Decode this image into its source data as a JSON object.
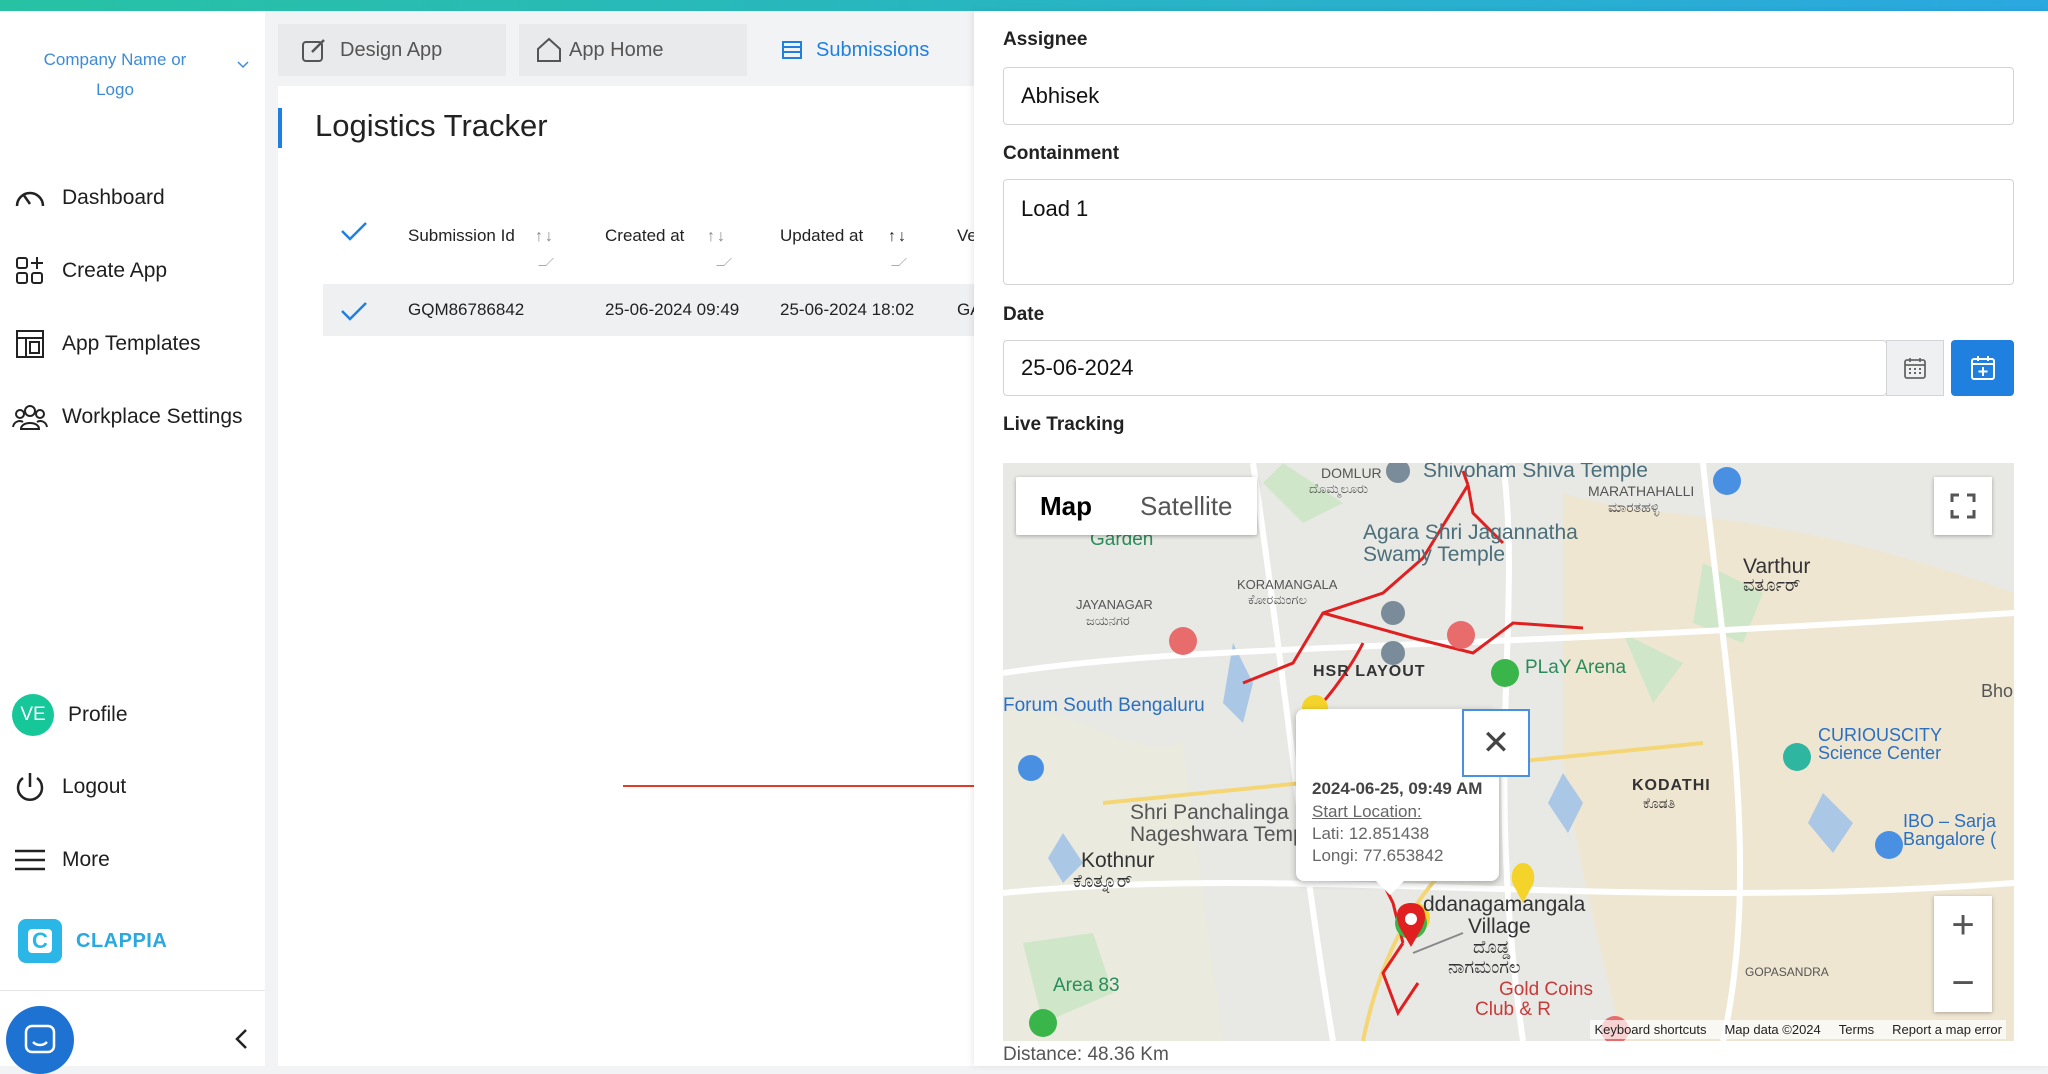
{
  "sidebar": {
    "company": "Company Name or Logo",
    "nav": [
      {
        "label": "Dashboard",
        "icon": "gauge-icon"
      },
      {
        "label": "Create App",
        "icon": "grid-plus-icon"
      },
      {
        "label": "App Templates",
        "icon": "template-icon"
      },
      {
        "label": "Workplace Settings",
        "icon": "people-icon"
      }
    ],
    "profile": {
      "initials": "VE",
      "label": "Profile"
    },
    "logout": "Logout",
    "more": "More",
    "brand": "CLAPPIA"
  },
  "tabs": [
    {
      "label": "Design App",
      "icon": "edit-icon"
    },
    {
      "label": "App Home",
      "icon": "home-icon"
    },
    {
      "label": "Submissions",
      "icon": "table-icon"
    }
  ],
  "page": {
    "title": "Logistics Tracker"
  },
  "table": {
    "columns": [
      "Submission Id",
      "Created at",
      "Updated at",
      "Ve"
    ],
    "rows": [
      {
        "id": "GQM86786842",
        "created": "25-06-2024 09:49",
        "updated": "25-06-2024 18:02",
        "extra": "GA"
      }
    ]
  },
  "form": {
    "assignee_label": "Assignee",
    "assignee_value": "Abhisek",
    "containment_label": "Containment",
    "containment_value": "Load 1",
    "date_label": "Date",
    "date_value": "25-06-2024",
    "tracking_label": "Live Tracking",
    "distance": "Distance: 48.36 Km"
  },
  "map": {
    "toggle": [
      "Map",
      "Satellite"
    ],
    "info": {
      "time": "2024-06-25, 09:49 AM",
      "start": "Start Location:",
      "lat": "Lati: 12.851438",
      "lng": "Longi: 77.653842"
    },
    "places": {
      "domlur": "DOMLUR",
      "domlur_kn": "ದೊಮ್ಮಲೂರು",
      "shivoham": "Shivoham Shiva Temple",
      "marathahalli": "MARATHAHALLI",
      "marathahalli_kn": "ಮಾರತಹಳ್ಳಿ",
      "garden": "Garden",
      "agara1": "Agara Shri Jagannatha",
      "agara2": "Swamy Temple",
      "koramangala": "KORAMANGALA",
      "koramangala_kn": "ಕೋರಮಂಗಲ",
      "jayanagar": "JAYANAGAR",
      "jayanagar_kn": "ಜಯನಗರ",
      "varthur": "Varthur",
      "varthur_kn": "ವರ್ತೂರ್",
      "hsr": "HSR LAYOUT",
      "play": "PLaY Arena",
      "forum": "Forum South Bengaluru",
      "curio1": "CURIOUSCITY",
      "curio2": "Science Center",
      "kodathi": "KODATHI",
      "kodathi_kn": "ಕೊಡತಿ",
      "shri1": "Shri Panchalinga",
      "shri2": "Nageshwara Temple",
      "ibo1": "IBO – Sarja",
      "ibo2": "Bangalore (",
      "kothnur": "Kothnur",
      "kothnur_kn": "ಕೊತ್ನೂರ್",
      "dodda": "ddanagamangala",
      "village": "Village",
      "dodda_kn1": "ದೊಡ್ಡ",
      "dodda_kn2": "ನಾಗಮಂಗಲ",
      "gopa": "GOPASANDRA",
      "area83": "Area 83",
      "gold": "Gold Coins",
      "club": "Club & R",
      "bho": "Bho"
    },
    "footer": [
      "Keyboard shortcuts",
      "Map data ©2024",
      "Terms",
      "Report a map error"
    ]
  }
}
